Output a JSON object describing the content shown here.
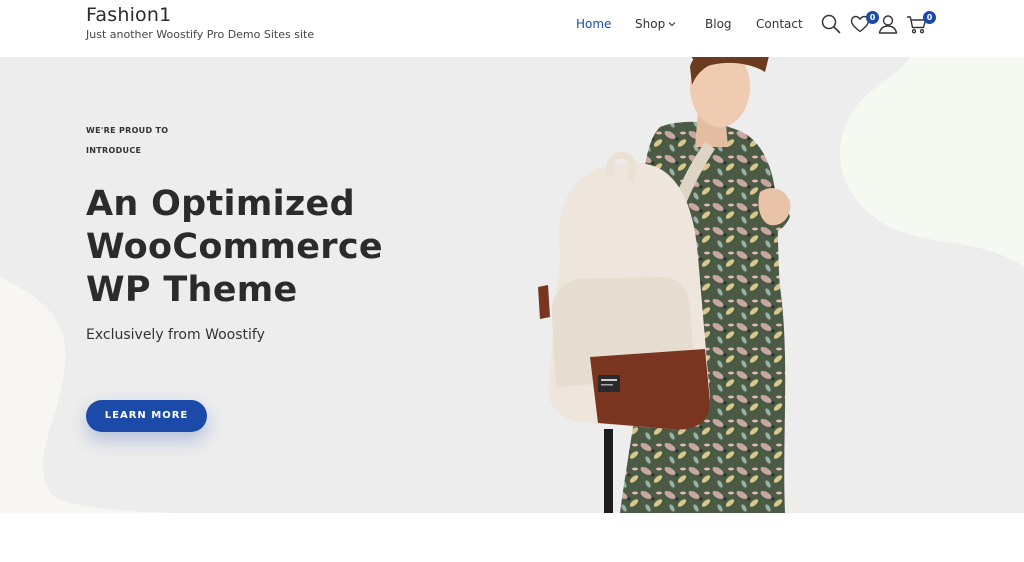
{
  "site": {
    "title": "Fashion1",
    "tagline": "Just another Woostify Pro Demo Sites site"
  },
  "nav": {
    "items": [
      {
        "label": "Home",
        "active": true
      },
      {
        "label": "Shop",
        "has_dropdown": true
      },
      {
        "label": "Blog"
      },
      {
        "label": "Contact"
      }
    ]
  },
  "header_icons": {
    "search": "search-icon",
    "wishlist": {
      "icon": "heart-icon",
      "count": "0"
    },
    "account": "user-icon",
    "cart": {
      "icon": "cart-icon",
      "count": "0"
    }
  },
  "hero": {
    "eyebrow_line1": "WE'RE PROUD TO",
    "eyebrow_line2": "INTRODUCE",
    "headline_line1": "An Optimized",
    "headline_line2": "WooCommerce",
    "headline_line3": "WP Theme",
    "subheading": "Exclusively from Woostify",
    "cta_label": "LEARN MORE"
  },
  "colors": {
    "accent": "#1c4aa8",
    "hero_bg": "#ededed",
    "text": "#2b2b2b"
  }
}
